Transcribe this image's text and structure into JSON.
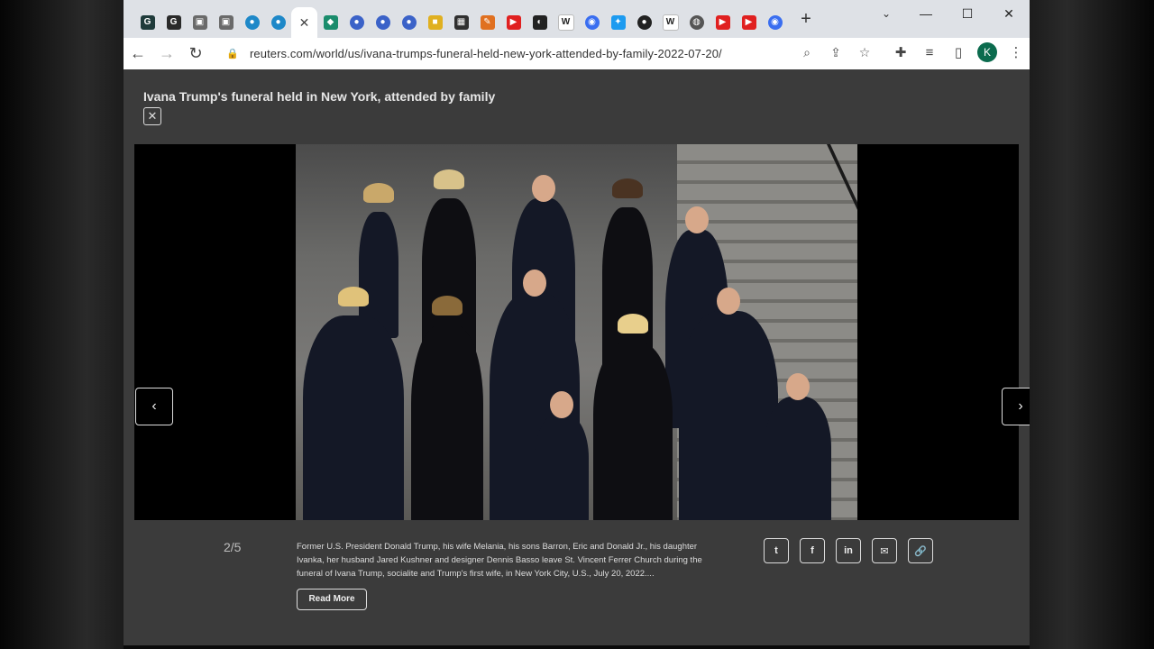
{
  "tabs": [
    {
      "icon": "g-dark-icon",
      "glyph": "G",
      "color": "#1f3b3b"
    },
    {
      "icon": "g-dark-icon",
      "glyph": "G",
      "color": "#2a2a2a"
    },
    {
      "icon": "printer-icon",
      "glyph": "▣",
      "color": "#6a6a6a"
    },
    {
      "icon": "printer-icon",
      "glyph": "▣",
      "color": "#6a6a6a"
    },
    {
      "icon": "globe-blue-icon",
      "glyph": "●",
      "color": "#1e88c8"
    },
    {
      "icon": "globe-blue-icon",
      "glyph": "●",
      "color": "#1e88c8"
    },
    {
      "icon": "close-icon",
      "glyph": "✕",
      "color": "#ffffff",
      "active": true
    },
    {
      "icon": "leaf-icon",
      "glyph": "◆",
      "color": "#1a8c6c"
    },
    {
      "icon": "planet-icon",
      "glyph": "●",
      "color": "#3b62c8"
    },
    {
      "icon": "planet-icon",
      "glyph": "●",
      "color": "#3b62c8"
    },
    {
      "icon": "planet-icon",
      "glyph": "●",
      "color": "#3b62c8"
    },
    {
      "icon": "folder-icon",
      "glyph": "■",
      "color": "#e0b020"
    },
    {
      "icon": "terminal-icon",
      "glyph": "▦",
      "color": "#303030"
    },
    {
      "icon": "pencil-icon",
      "glyph": "✎",
      "color": "#e07020"
    },
    {
      "icon": "youtube-icon",
      "glyph": "▶",
      "color": "#e02020"
    },
    {
      "icon": "ghost-icon",
      "glyph": "◐",
      "color": "#222222"
    },
    {
      "icon": "wikipedia-icon",
      "glyph": "W",
      "color": "#ffffff"
    },
    {
      "icon": "messenger-icon",
      "glyph": "◉",
      "color": "#3a6ef0"
    },
    {
      "icon": "twitter-icon",
      "glyph": "✦",
      "color": "#1d9bf0"
    },
    {
      "icon": "dot-icon",
      "glyph": "●",
      "color": "#222222"
    },
    {
      "icon": "wikipedia-icon",
      "glyph": "W",
      "color": "#ffffff"
    },
    {
      "icon": "globe-gray-icon",
      "glyph": "◍",
      "color": "#555555"
    },
    {
      "icon": "youtube-icon",
      "glyph": "▶",
      "color": "#e02020"
    },
    {
      "icon": "youtube-icon",
      "glyph": "▶",
      "color": "#e02020"
    },
    {
      "icon": "messenger-icon",
      "glyph": "◉",
      "color": "#3a6ef0"
    }
  ],
  "toolbar": {
    "url": "reuters.com/world/us/ivana-trumps-funeral-held-new-york-attended-by-family-2022-07-20/",
    "avatar_letter": "K"
  },
  "gallery": {
    "title": "Ivana Trump's funeral held in New York, attended by family",
    "counter": "2/5",
    "caption": "Former U.S. President Donald Trump, his wife Melania, his sons Barron, Eric and Donald Jr., his daughter Ivanka, her husband Jared Kushner and designer Dennis Basso leave St. Vincent Ferrer Church during the funeral of Ivana Trump, socialite and Trump's first wife, in New York City, U.S., July 20, 2022....",
    "read_more": "Read More"
  },
  "share": [
    {
      "icon": "twitter-icon",
      "glyph": "t"
    },
    {
      "icon": "facebook-icon",
      "glyph": "f"
    },
    {
      "icon": "linkedin-icon",
      "glyph": "in"
    },
    {
      "icon": "email-icon",
      "glyph": "✉"
    },
    {
      "icon": "link-icon",
      "glyph": "🔗"
    }
  ]
}
